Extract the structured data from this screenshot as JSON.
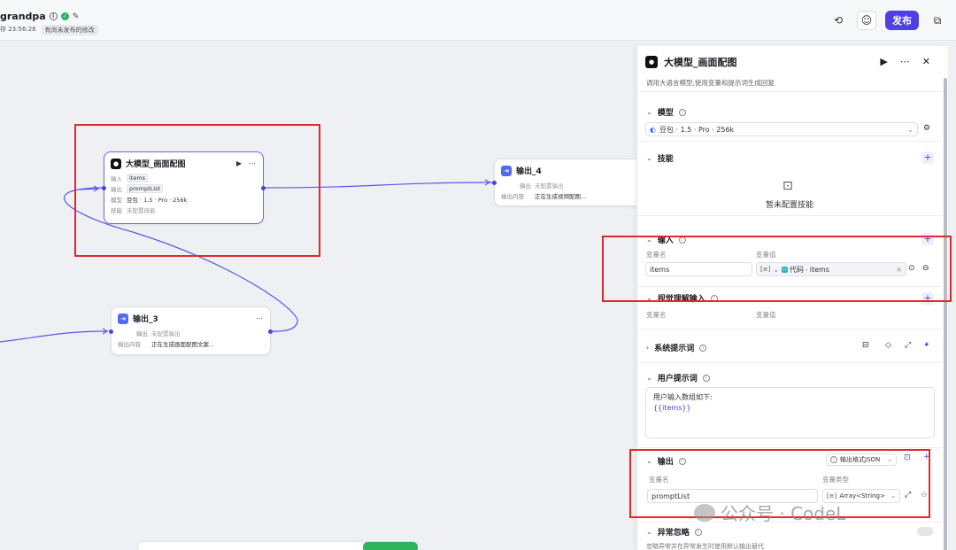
{
  "topbar": {
    "title": "grandpa",
    "save_status": "存 23:56:26",
    "unpublished": "有尚未发布的修改",
    "publish_label": "发布"
  },
  "canvas": {
    "llm_node": {
      "title": "大模型_画面配图",
      "input_label": "输入",
      "input_value": "items",
      "output_label": "输出",
      "output_value": "promptList",
      "model_label": "模型",
      "model_value": "豆包 · 1.5 · Pro · 256k",
      "skills_label": "技能",
      "skills_value": "未配置技能"
    },
    "output4_node": {
      "title": "输出_4",
      "output_label": "输出",
      "output_value": "未配置输出",
      "content_label": "输出内容",
      "content_value": "正在生成视频配图..."
    },
    "output3_node": {
      "title": "输出_3",
      "output_label": "输出",
      "output_value": "未配置输出",
      "content_label": "输出内容",
      "content_value": "正在生成画面配图文案..."
    }
  },
  "panel": {
    "title": "大模型_画面配图",
    "description": "调用大语言模型,使用变量和提示词生成回复",
    "model": {
      "label": "模型",
      "value": "豆包 · 1.5 · Pro · 256k"
    },
    "skills": {
      "label": "技能",
      "empty": "暂未配置技能"
    },
    "input": {
      "label": "输入",
      "col_name": "变量名",
      "col_value": "变量值",
      "var_name": "items",
      "ref_source": "代码",
      "ref_var": "items"
    },
    "vision_input": {
      "label": "视觉理解输入",
      "col_name": "变量名",
      "col_value": "变量值"
    },
    "system_prompt": {
      "label": "系统提示词"
    },
    "user_prompt": {
      "label": "用户提示词",
      "line1": "用户输入数组如下:",
      "line2": "{{items}}"
    },
    "output": {
      "label": "输出",
      "format": "输出格式JSON",
      "col_name": "变量名",
      "col_type": "变量类型",
      "var_name": "promptList",
      "var_type": "Array<String>"
    },
    "exception": {
      "label": "异常忽略",
      "desc": "忽略异常并在异常发生时使用默认输出替代"
    }
  },
  "watermark": "公众号 · CodeL",
  "colors": {
    "accent": "#4e40e5",
    "annotation": "#e02a2a",
    "success": "#2cb35c"
  }
}
